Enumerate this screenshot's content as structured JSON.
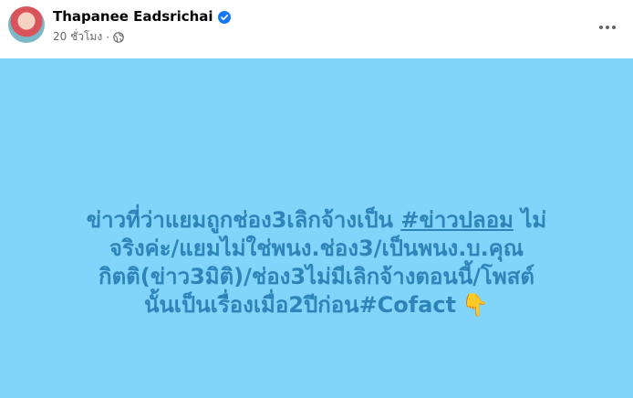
{
  "author": {
    "name": "Thapanee Eadsrichai",
    "time": "20 ชั่วโมง",
    "separator": "·"
  },
  "post": {
    "line1_prefix": "ข่าวที่ว่าแยมถูกช่อง3เลิกจ้างเป็น ",
    "line1_hashtag": "#ข่าวปลอม",
    "line1_suffix": " ไม่",
    "line2": "จริงค่ะ/แยมไม่ใช่พนง.ช่อง3/เป็นพนง.บ.คุณ",
    "line3": "กิตติ(ข่าว3มิติ)/ช่อง3ไม่มีเลิกจ้างตอนนี้/โพสต์",
    "line4": "นั้นเป็นเรื่องเมื่อ2ปีก่อน#Cofact",
    "emoji": "👇"
  },
  "colors": {
    "background": "#81d4fa",
    "text": "#2c84b9",
    "verified": "#1877f2"
  },
  "icons": {
    "verified": "verified-badge-icon",
    "privacy": "globe-icon",
    "more": "more-options-icon"
  }
}
